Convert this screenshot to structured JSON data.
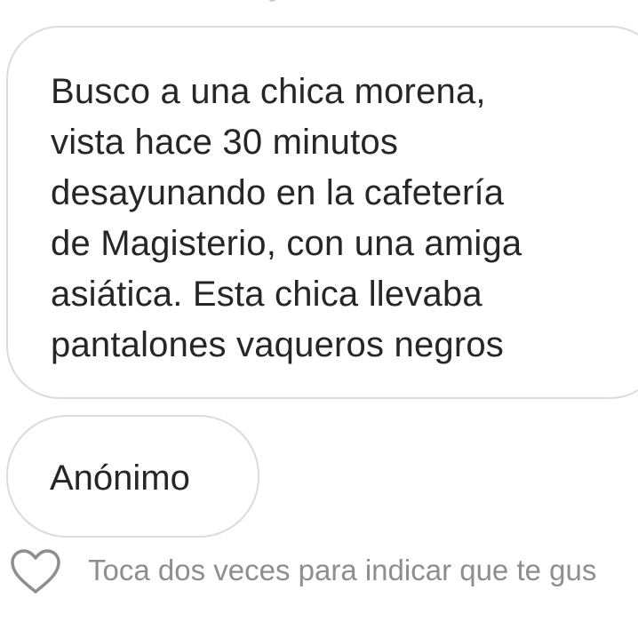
{
  "message": {
    "lines": [
      "Busco a una chica morena,",
      "vista hace 30 minutos",
      "desayunando en la cafetería",
      "de Magisterio, con una amiga",
      "asiática. Esta chica llevaba",
      "pantalones vaqueros negros"
    ]
  },
  "sender": {
    "label": "Anónimo"
  },
  "like": {
    "icon": "heart-outline-icon",
    "hint": "Toca dos veces para indicar que te gus"
  },
  "colors": {
    "text": "#262626",
    "hint": "#8e8e8e",
    "bubble_border": "#dbdbdb",
    "background": "#ffffff"
  }
}
